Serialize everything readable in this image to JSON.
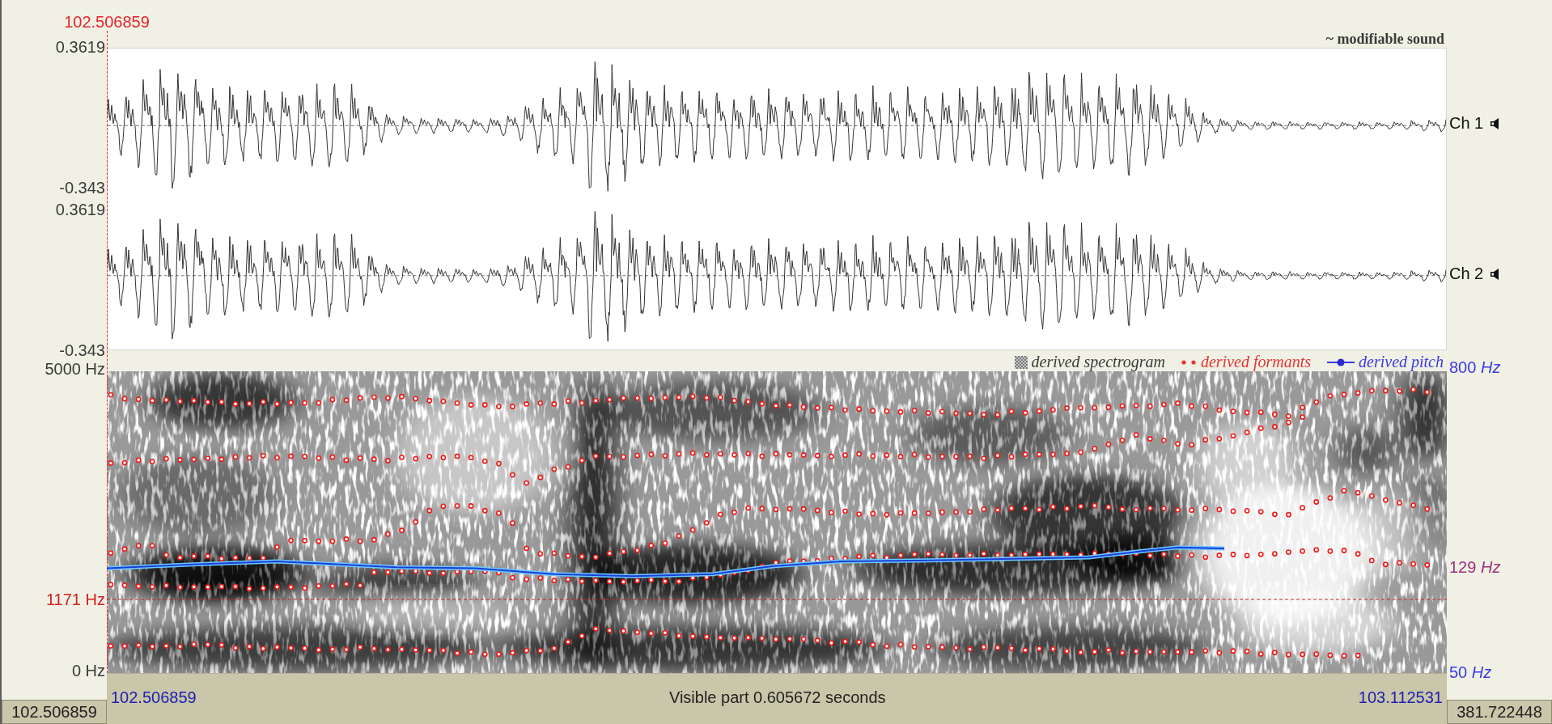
{
  "cursor": {
    "time": "102.506859",
    "frequency": "1171 Hz"
  },
  "sound": {
    "title": "~ modifiable sound",
    "channels": [
      {
        "label": "Ch 1",
        "max": "0.3619",
        "min": "-0.343"
      },
      {
        "label": "Ch 2",
        "max": "0.3619",
        "min": "-0.343"
      }
    ]
  },
  "analysis": {
    "legend": [
      {
        "kind": "spectrogram",
        "label": "derived spectrogram"
      },
      {
        "kind": "formants",
        "label": "derived formants"
      },
      {
        "kind": "pitch",
        "label": "derived pitch"
      }
    ],
    "frequency_axis": {
      "top": "5000 Hz",
      "bottom": "0 Hz"
    },
    "pitch_axis": {
      "top": "800 *Hz*",
      "marker": "129 *Hz*",
      "bottom": "50 *Hz*"
    }
  },
  "time_bar": {
    "start": "102.506859",
    "label": "Visible part 0.605672 seconds",
    "end": "103.112531"
  },
  "total_bar": {
    "start": "102.506859",
    "end": "381.722448"
  }
}
